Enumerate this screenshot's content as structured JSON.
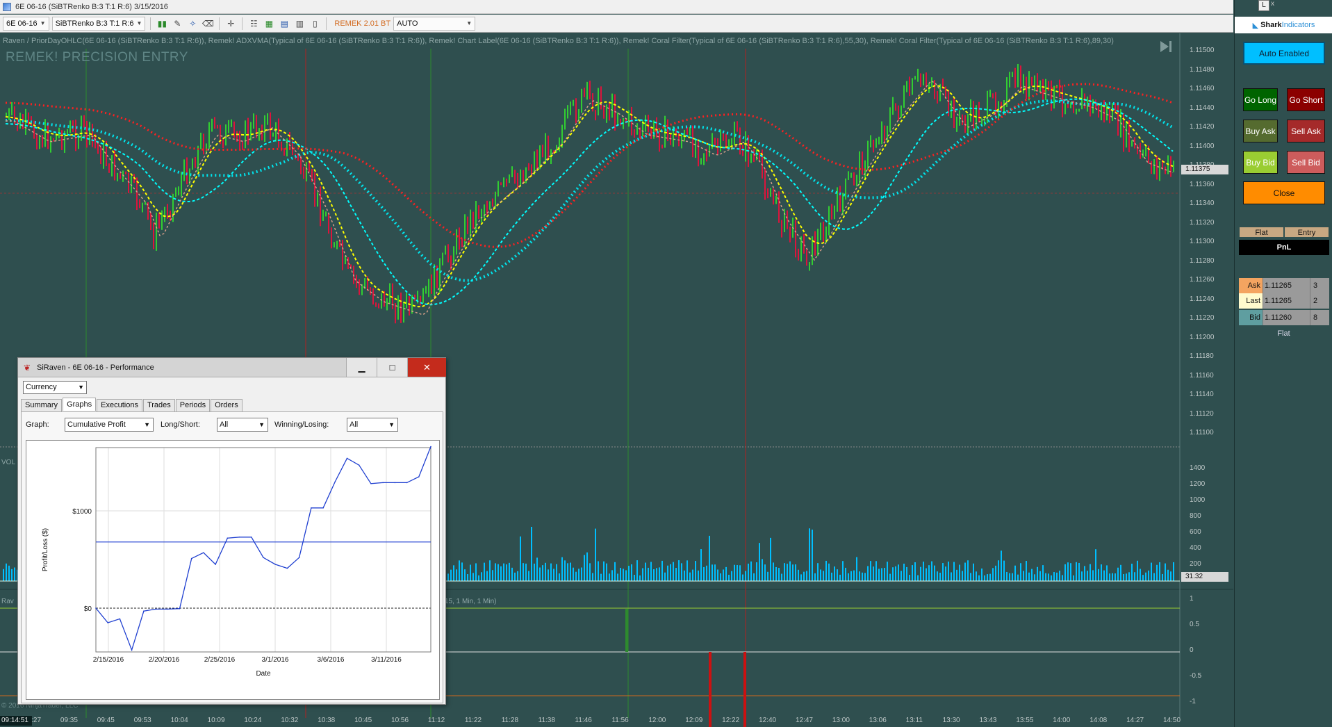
{
  "window": {
    "title": "6E 06-16 (SiBTRenko B:3 T:1 R:6)  3/15/2016"
  },
  "toolbar": {
    "instrument": "6E 06-16",
    "bar_type": "SiBTRenko B:3 T:1 R:6",
    "strategy": "REMEK 2.01 BT",
    "mode": "AUTO"
  },
  "chart": {
    "indicators_text": "Raven / PriorDayOHLC(6E 06-16 (SiBTRenko B:3 T:1 R:6)), Remek! ADXVMA(Typical of 6E 06-16 (SiBTRenko B:3 T:1 R:6)), Remek! Chart Label(6E 06-16 (SiBTRenko B:3 T:1 R:6)), Remek! Coral Filter(Typical of 6E 06-16 (SiBTRenko B:3 T:1 R:6),55,30), Remek! Coral Filter(Typical of 6E 06-16 (SiBTRenko B:3 T:1 R:6),89,30)",
    "watermark": "REMEK! PRECISION ENTRY",
    "price_ticks": [
      "1.11500",
      "1.11480",
      "1.11460",
      "1.11440",
      "1.11420",
      "1.11400",
      "1.11380",
      "1.11360",
      "1.11340",
      "1.11320",
      "1.11300",
      "1.11280",
      "1.11260",
      "1.11240",
      "1.11220",
      "1.11200",
      "1.11180",
      "1.11160",
      "1.11140",
      "1.11120",
      "1.11100"
    ],
    "current_price": "1.11375",
    "volume_label": "VOL",
    "volume_ticks": [
      "1400",
      "1200",
      "1000",
      "800",
      "600",
      "400",
      "200"
    ],
    "volume_value": "31.32",
    "osc_label": "Rav",
    "osc_params": "15, 1 Min, 1 Min)",
    "osc_ticks": [
      "1",
      "0.5",
      "0",
      "-0.5",
      "-1"
    ],
    "time_ticks": [
      "09:27",
      "09:35",
      "09:45",
      "09:53",
      "10:04",
      "10:09",
      "10:24",
      "10:32",
      "10:38",
      "10:45",
      "10:56",
      "11:12",
      "11:22",
      "11:28",
      "11:38",
      "11:46",
      "11:56",
      "12:00",
      "12:09",
      "12:22",
      "12:40",
      "12:47",
      "13:00",
      "13:06",
      "13:11",
      "13:30",
      "13:43",
      "13:55",
      "14:00",
      "14:08",
      "14:27",
      "14:50"
    ],
    "current_time": "09:14:51",
    "copyright": "© 2016 NinjaTrader, LLC",
    "colors": {
      "background": "#2f4f4f",
      "up": "#32cd32",
      "down": "#dc143c",
      "adx": "#ffff00",
      "coral_fast": "#00ffff",
      "coral_slow": "#ff2020"
    }
  },
  "side": {
    "logo_main": "Shark",
    "logo_sub": "Indicators",
    "lock": "L",
    "close": "x",
    "auto_enabled": "Auto Enabled",
    "go_long": "Go Long",
    "go_short": "Go Short",
    "buy_ask": "Buy Ask",
    "sell_ask": "Sell Ask",
    "buy_bid": "Buy Bid",
    "sell_bid": "Sell Bid",
    "close_btn": "Close",
    "pos_flat": "Flat",
    "pos_entry": "Entry",
    "pnl": "PnL",
    "ask": {
      "label": "Ask",
      "price": "1.11265",
      "size": "3"
    },
    "last": {
      "label": "Last",
      "price": "1.11265",
      "size": "2"
    },
    "bid": {
      "label": "Bid",
      "price": "1.11260",
      "size": "8"
    },
    "status": "Flat"
  },
  "perf": {
    "title": "SiRaven - 6E 06-16 - Performance",
    "currency": "Currency",
    "tabs": [
      "Summary",
      "Graphs",
      "Executions",
      "Trades",
      "Periods",
      "Orders"
    ],
    "active_tab": "Graphs",
    "graph_label": "Graph:",
    "graph_value": "Cumulative Profit",
    "ls_label": "Long/Short:",
    "ls_value": "All",
    "wl_label": "Winning/Losing:",
    "wl_value": "All"
  },
  "chart_data": {
    "type": "line",
    "title": "",
    "xlabel": "Date",
    "ylabel": "Profit/Loss ($)",
    "x_ticks": [
      "2/15/2016",
      "2/20/2016",
      "2/25/2016",
      "3/1/2016",
      "3/6/2016",
      "3/11/2016"
    ],
    "y_ticks": [
      "$1000",
      "$0"
    ],
    "ylim": [
      -450,
      1650
    ],
    "reference_line": 680,
    "series": [
      {
        "values": [
          0,
          -150,
          -110,
          -430,
          -30,
          -10,
          -10,
          -5,
          510,
          570,
          450,
          720,
          730,
          730,
          520,
          450,
          410,
          520,
          1030,
          1030,
          1300,
          1540,
          1470,
          1280,
          1290,
          1290,
          1290,
          1350,
          1660
        ]
      }
    ]
  }
}
